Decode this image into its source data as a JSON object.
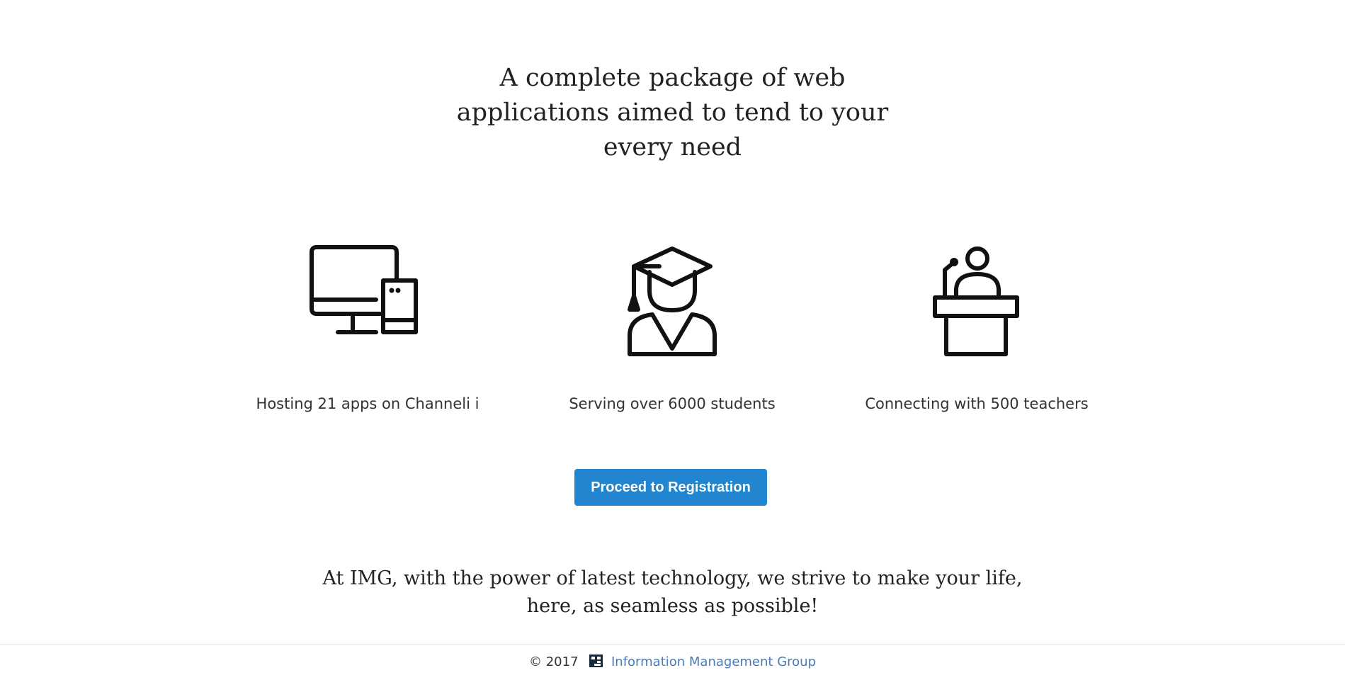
{
  "headline": {
    "line1": "A complete package of web",
    "line2": "applications aimed to tend to your",
    "line3": "every need"
  },
  "features": [
    {
      "icon": "devices-icon",
      "label": "Hosting 21 apps on Channeli i"
    },
    {
      "icon": "graduate-icon",
      "label": "Serving over 6000 students"
    },
    {
      "icon": "teacher-podium-icon",
      "label": "Connecting with 500 teachers"
    }
  ],
  "cta": {
    "label": "Proceed to Registration"
  },
  "tagline": {
    "line1": "At IMG, with the power of latest technology, we strive to make your life,",
    "line2": "here, as seamless as possible!"
  },
  "footer": {
    "copyright": "© 2017",
    "logo_icon": "img-logo-icon",
    "link_text": "Information Management Group"
  },
  "colors": {
    "accent": "#2185d0",
    "link": "#4a7ab8",
    "text": "#222222"
  }
}
